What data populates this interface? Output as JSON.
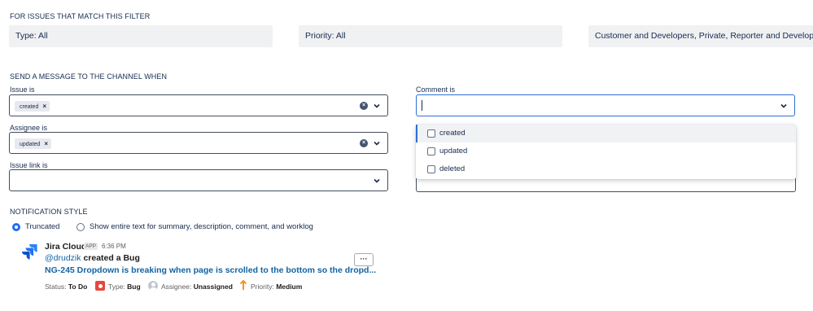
{
  "filter": {
    "title": "FOR ISSUES THAT MATCH THIS FILTER",
    "type": "Type: All",
    "priority": "Priority: All",
    "visibility": "Customer and Developers, Private, Reporter and Developers"
  },
  "send": {
    "title": "SEND A MESSAGE TO THE CHANNEL WHEN",
    "issue_label": "Issue is",
    "issue_chip": "created",
    "assignee_label": "Assignee is",
    "assignee_chip": "updated",
    "issue_link_label": "Issue link is",
    "comment_label": "Comment is",
    "comment_options": [
      "created",
      "updated",
      "deleted"
    ]
  },
  "style": {
    "title": "NOTIFICATION STYLE",
    "option_truncated": "Truncated",
    "option_full": "Show entire text for summary, description, comment, and worklog",
    "selected": "Truncated"
  },
  "preview": {
    "sender": "Jira Cloud",
    "badge": "APP",
    "time": "6:36 PM",
    "mention": "@drudzik",
    "action": "created a Bug",
    "link": "NG-245 Dropdown is breaking when page is scrolled to the bottom so the dropd...",
    "more": "···",
    "status_label": "Status:",
    "status_value": "To Do",
    "type_label": "Type:",
    "type_value": "Bug",
    "assignee_label": "Assignee:",
    "assignee_value": "Unassigned",
    "priority_label": "Priority:",
    "priority_value": "Medium"
  },
  "colors": {
    "accent": "#2f6fd6",
    "link": "#1264a3",
    "bug": "#e5493a",
    "priority_medium": "#f18d13"
  }
}
